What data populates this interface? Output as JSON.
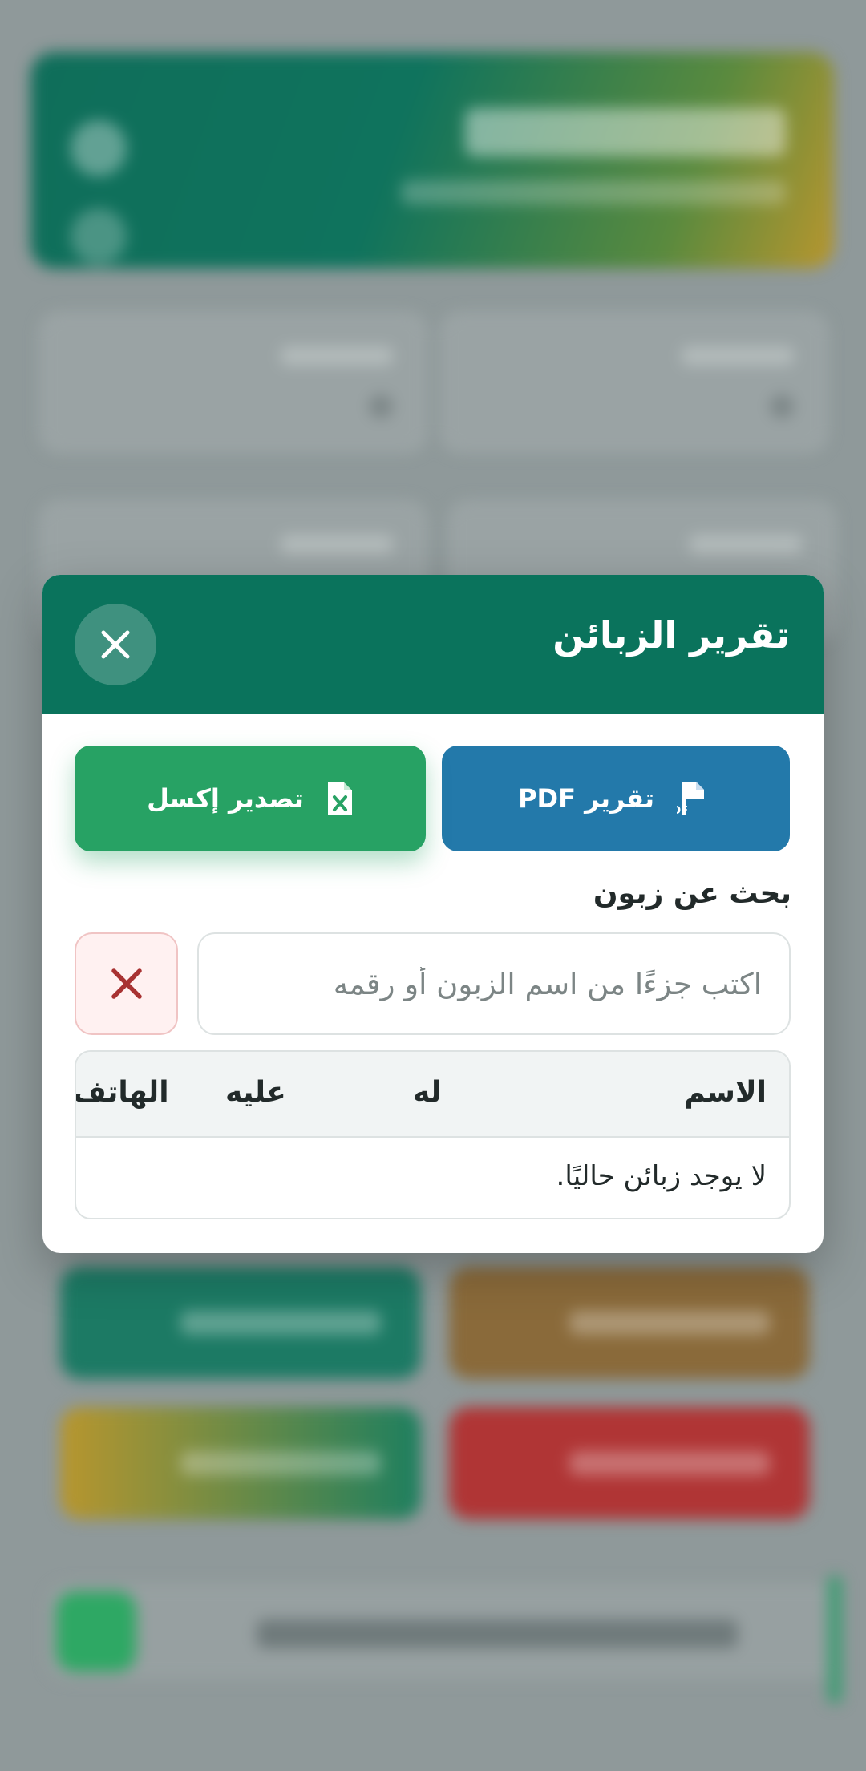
{
  "modal": {
    "title": "تقرير الزبائن",
    "buttons": {
      "pdf_label": "تقرير PDF",
      "excel_label": "تصدير إكسل"
    },
    "search": {
      "label": "بحث عن زبون",
      "placeholder": "اكتب جزءًا من اسم الزبون أو رقمه",
      "value": ""
    },
    "table": {
      "columns": [
        "الاسم",
        "له",
        "عليه",
        "الهاتف"
      ],
      "empty_message": "لا يوجد زبائن حاليًا."
    }
  },
  "colors": {
    "header": "#0a735c",
    "pdf_button": "#2379aa",
    "excel_button": "#27a264",
    "clear_button_icon": "#a83232"
  },
  "icons": {
    "close": "close-icon",
    "pdf": "file-pdf-icon",
    "excel": "file-excel-icon",
    "clear": "clear-icon"
  }
}
